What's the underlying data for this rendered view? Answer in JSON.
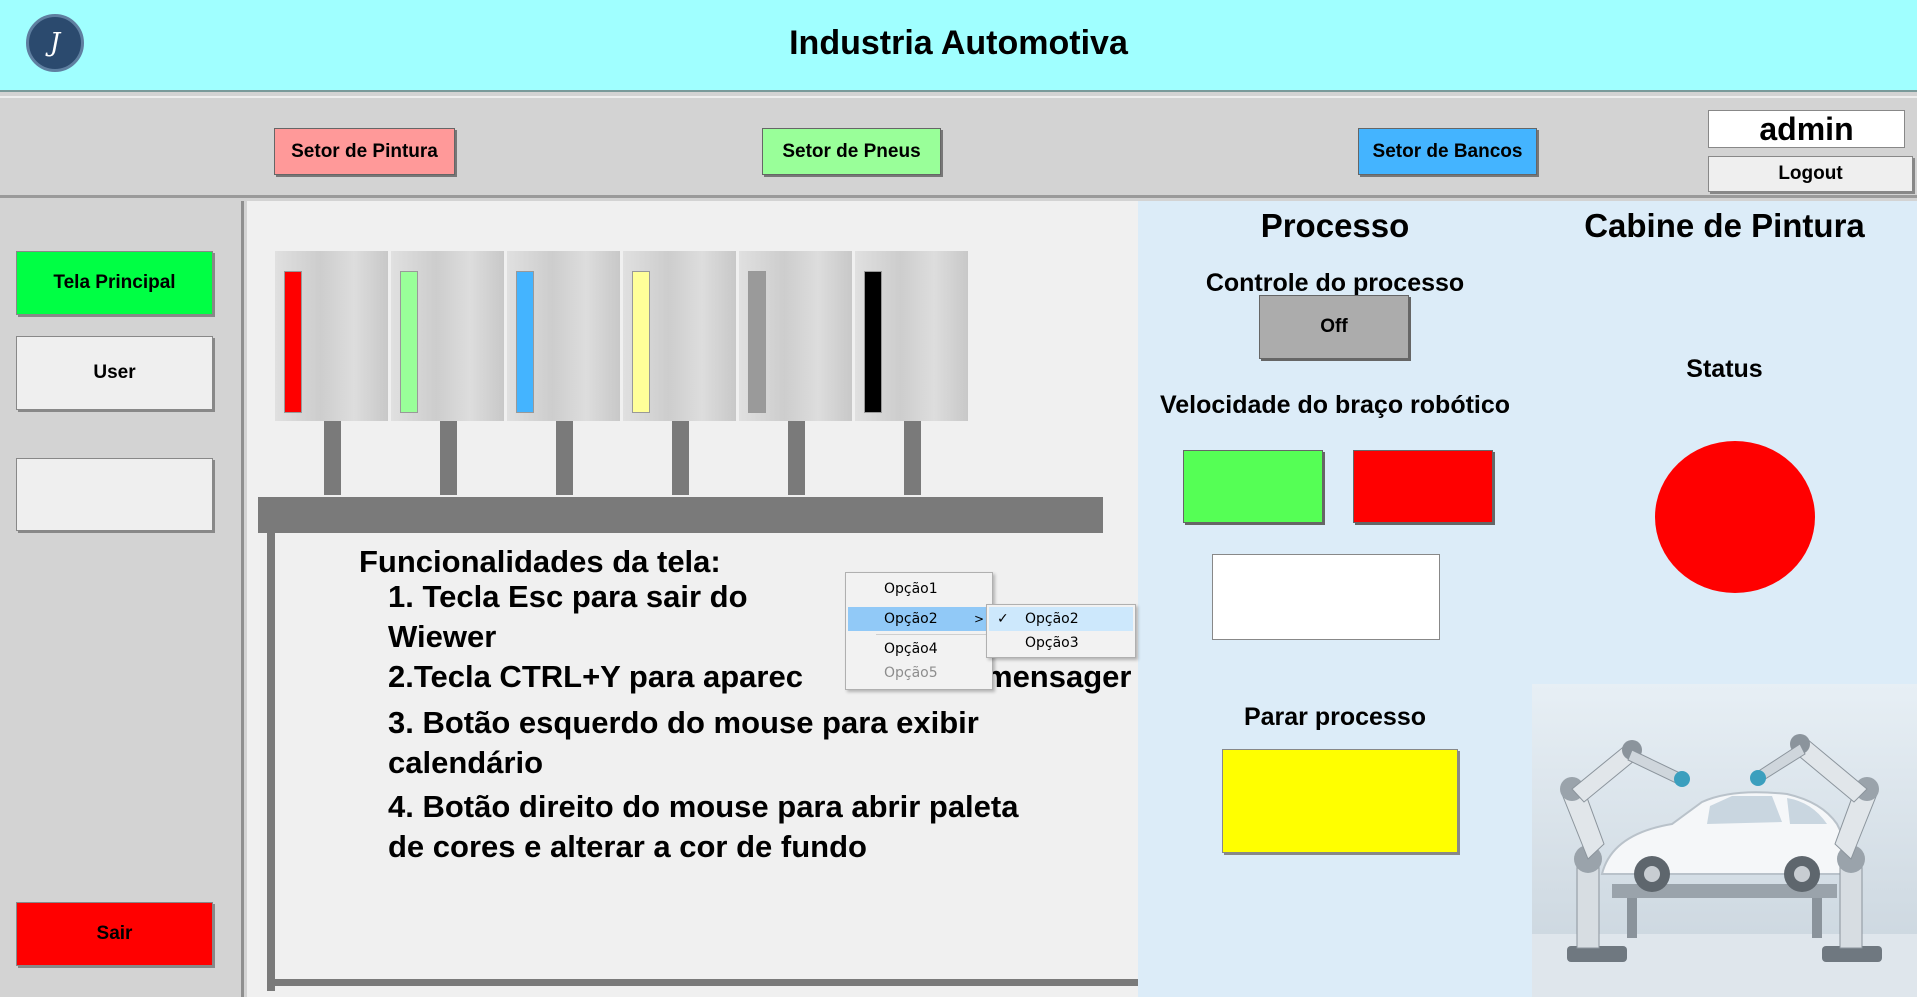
{
  "header": {
    "title": "Industria Automotiva",
    "logo_letter": "J"
  },
  "toolbar": {
    "sectors": [
      {
        "label": "Setor de Pintura",
        "color": "#ff9999"
      },
      {
        "label": "Setor de Pneus",
        "color": "#99ff99"
      },
      {
        "label": "Setor de Bancos",
        "color": "#44b4ff"
      }
    ],
    "user": "admin",
    "logout": "Logout"
  },
  "sidebar": {
    "main_screen": "Tela Principal",
    "user": "User",
    "blank": "",
    "exit": "Sair",
    "colors": {
      "main": "#00ff44",
      "exit": "#ff0000"
    }
  },
  "tanks": [
    {
      "color": "#ff0000",
      "level": 1.0
    },
    {
      "color": "#99ff99",
      "level": 1.0
    },
    {
      "color": "#44b4ff",
      "level": 1.0
    },
    {
      "color": "#ffff99",
      "level": 1.0
    },
    {
      "color": "#9a9a9a",
      "level": 1.0
    },
    {
      "color": "#000000",
      "level": 1.0
    }
  ],
  "functions": {
    "title": "Funcionalidades da tela:",
    "items": [
      "1. Tecla Esc para sair do",
      "Wiewer",
      "2.Tecla CTRL+Y para aparec",
      "mensager",
      "3. Botão esquerdo do mouse para exibir",
      "calendário",
      "4. Botão direito do mouse para abrir paleta",
      "de cores e alterar a cor de fundo"
    ]
  },
  "context_menu": {
    "items": [
      "Opção1",
      "Opção2",
      "Opção4",
      "Opção5"
    ],
    "submenu": [
      "Opção2",
      "Opção3"
    ],
    "arrow": ">",
    "check": "✓"
  },
  "process": {
    "title": "Processo",
    "control_label": "Controle do processo",
    "toggle": "Off",
    "speed_label": "Velocidade do braço robótico",
    "speed_value": "",
    "stop_label": "Parar processo"
  },
  "cabin": {
    "title": "Cabine de Pintura",
    "status_label": "Status",
    "status_color": "#ff0000"
  }
}
